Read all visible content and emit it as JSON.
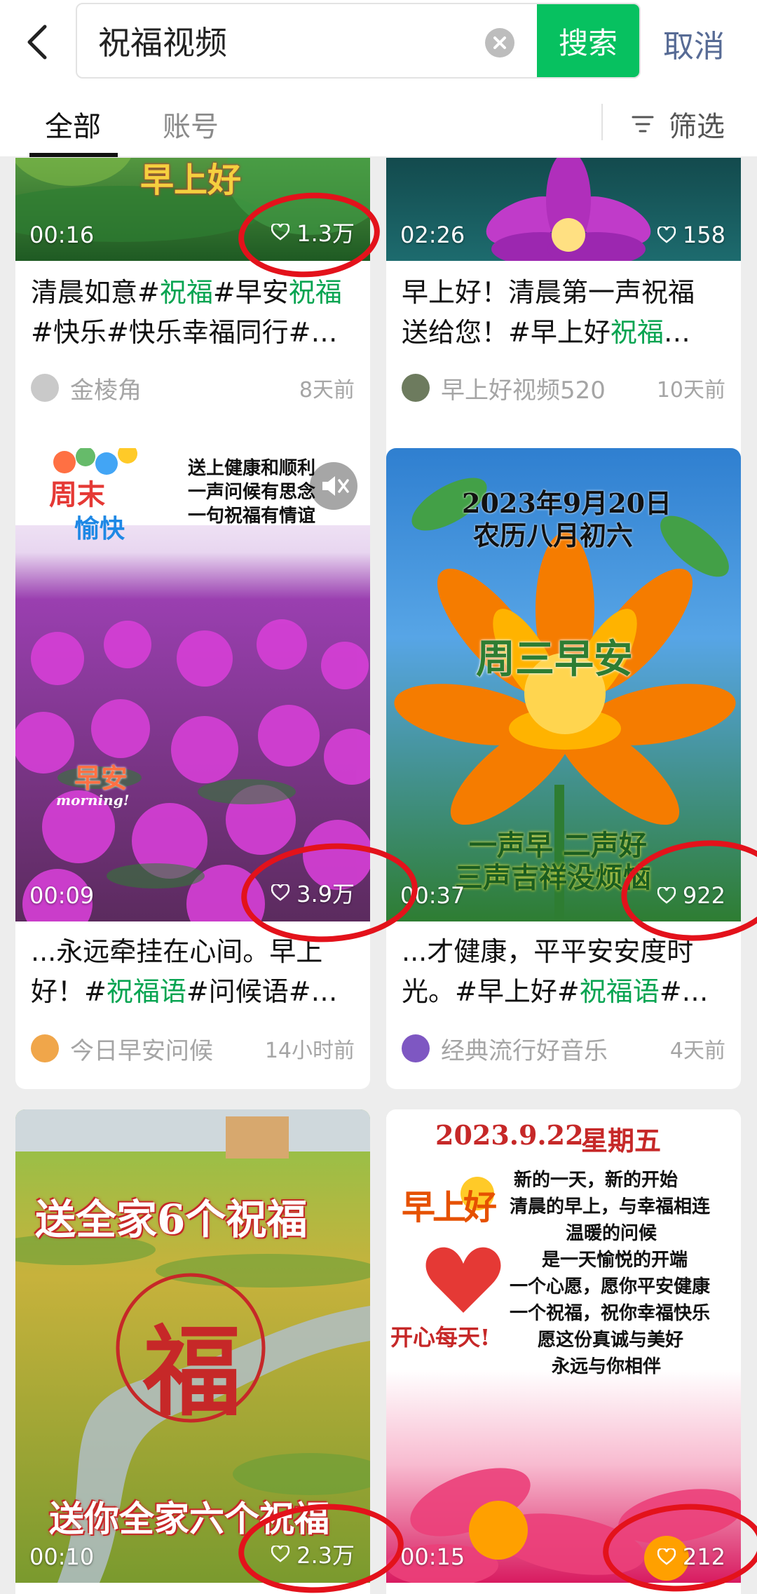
{
  "header": {
    "query": "祝福视频",
    "search_label": "搜索",
    "cancel_label": "取消",
    "tabs": [
      {
        "label": "全部",
        "active": true
      },
      {
        "label": "账号",
        "active": false
      }
    ],
    "filter_label": "筛选"
  },
  "colors": {
    "accent": "#07c160",
    "hashtag": "#07a451",
    "annotation": "#e3121b"
  },
  "cards": [
    {
      "duration": "00:16",
      "likes": "1.3万",
      "caption_line1": [
        "清晨如意#",
        "祝福",
        "#早安",
        "祝福"
      ],
      "caption_line2": "#快乐#快乐幸福同行#…",
      "author": "金棱角",
      "time": "8天前",
      "overlay_text": "早上好"
    },
    {
      "duration": "02:26",
      "likes": "158",
      "caption_line1": "早上好！清晨第一声祝福",
      "caption_line2": [
        "送给您！#早上好",
        "祝福",
        "…"
      ],
      "author": "早上好视频520",
      "time": "10天前"
    },
    {
      "duration": "00:09",
      "likes": "3.9万",
      "caption_line1": "...永远牵挂在心间。早上",
      "caption_line2": [
        "好！#",
        "祝福语",
        "#问候语#…"
      ],
      "author": "今日早安问候",
      "time": "14小时前",
      "overlay": {
        "tag1": "周末",
        "tag2": "愉快",
        "poem": [
          "送上健康和顺利",
          "一声问候有思念",
          "一句祝福有情谊"
        ],
        "stamp": "早安",
        "stamp_sub": "morning!"
      }
    },
    {
      "duration": "00:37",
      "likes": "922",
      "caption_line1": "...才健康，平平安安度时",
      "caption_line2": [
        "光。#早上好#",
        "祝福语",
        "#…"
      ],
      "author": "经典流行好音乐",
      "time": "4天前",
      "overlay": {
        "date": "2023年9月20日",
        "lunar": "农历八月初六",
        "title": "周三早安",
        "line1": "一声早 二声好",
        "line2": "三声吉祥没烦恼"
      }
    },
    {
      "duration": "00:10",
      "likes": "2.3万",
      "overlay": {
        "top": "送全家6个祝福",
        "center": "福",
        "bottom": "送你全家六个祝福"
      }
    },
    {
      "duration": "00:15",
      "likes": "212",
      "overlay": {
        "header": "2023.9.22",
        "weekday": "星期五",
        "greeting": "早上好",
        "daily": "开心每天!",
        "poem": [
          "新的一天，新的开始",
          "清晨的早上，与幸福相连",
          "温暖的问候",
          "是一天愉悦的开端",
          "一个心愿，愿你平安健康",
          "一个祝福，祝你幸福快乐",
          "愿这份真诚与美好",
          "永远与你相伴"
        ]
      }
    }
  ]
}
